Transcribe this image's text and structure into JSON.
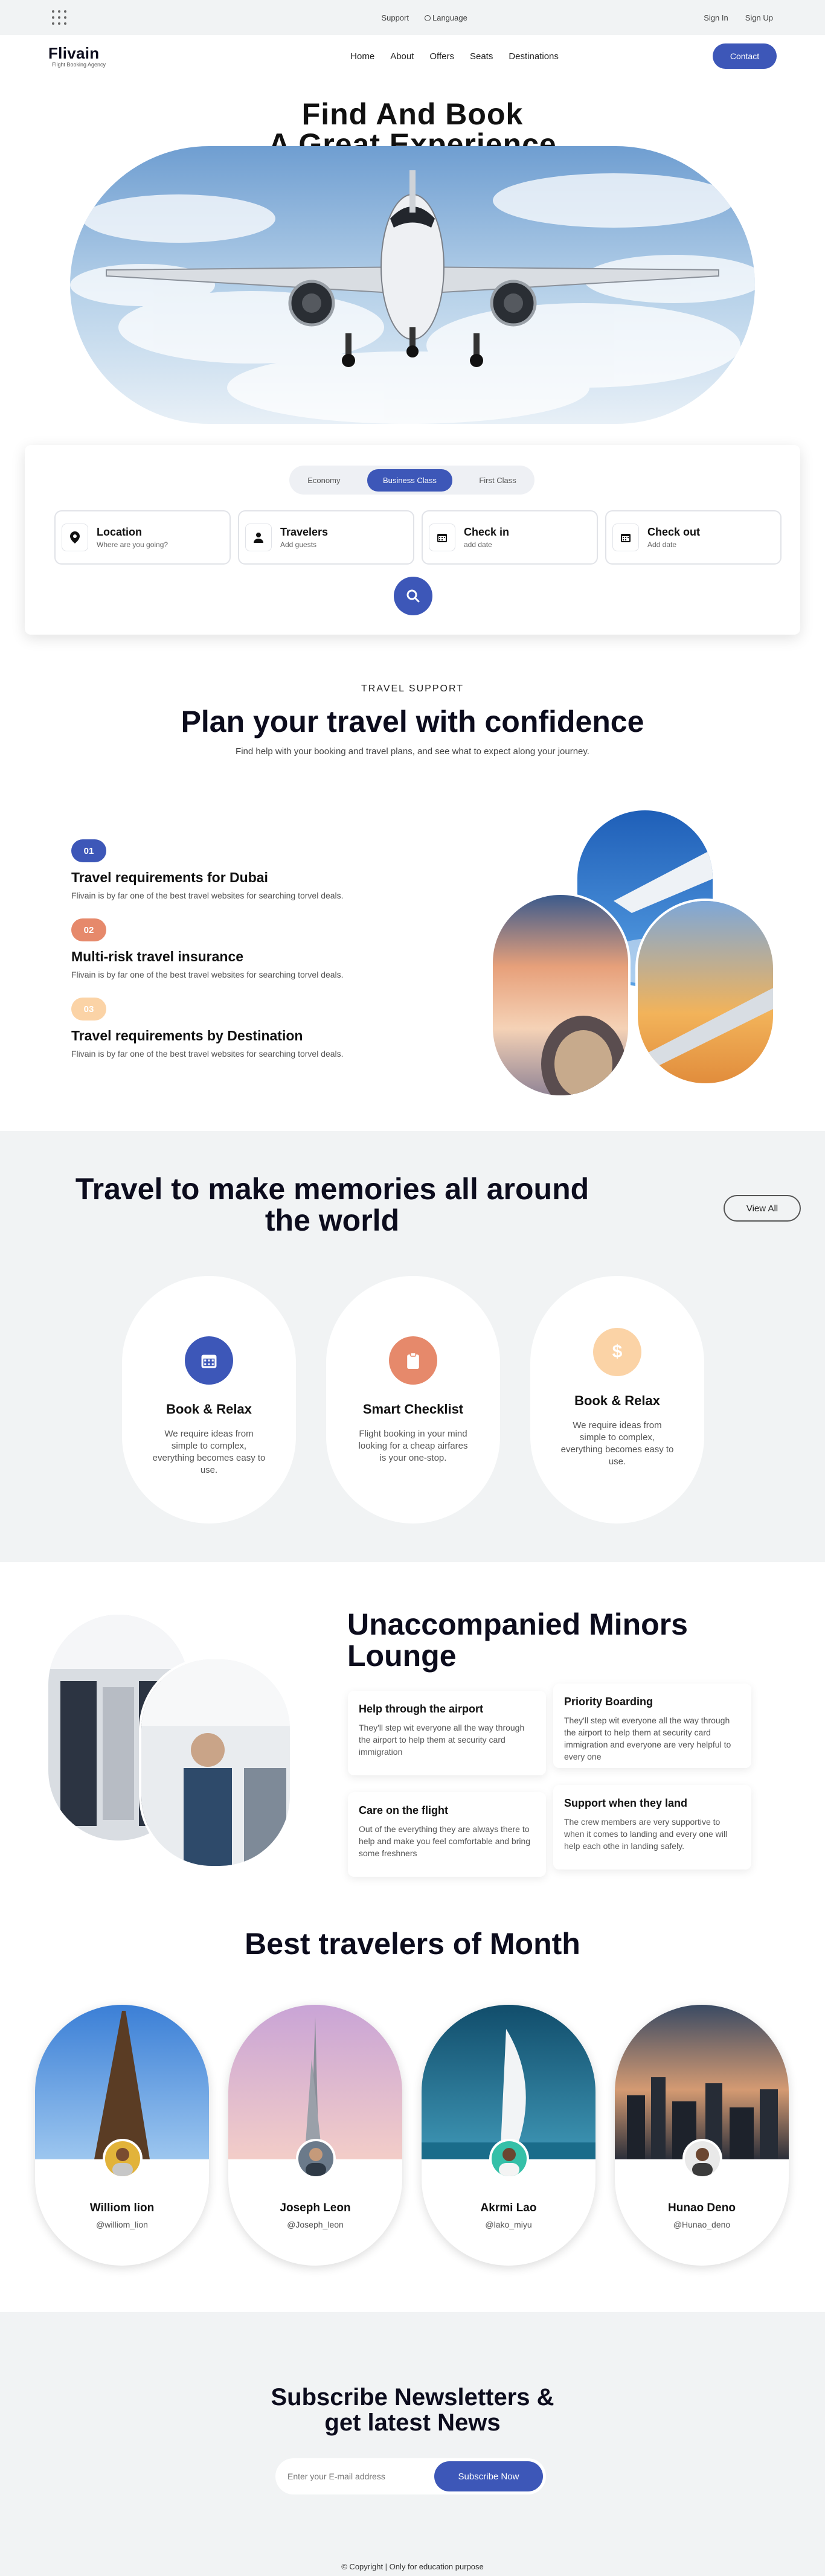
{
  "topbar": {
    "support": "Support",
    "language": "Language",
    "signin": "Sign In",
    "signup": "Sign Up"
  },
  "nav": {
    "logo": "Flivain",
    "tagline": "Flight Booking Agency",
    "items": [
      "Home",
      "About",
      "Offers",
      "Seats",
      "Destinations"
    ],
    "contact": "Contact"
  },
  "hero": {
    "line1": "Find And Book",
    "line2": "A Great Experience"
  },
  "booking": {
    "classes": [
      "Economy",
      "Business Class",
      "First Class"
    ],
    "active_class": "Business Class",
    "fields": [
      {
        "title": "Location",
        "sub": "Where are you going?",
        "icon": "location-pin-icon"
      },
      {
        "title": "Travelers",
        "sub": "Add guests",
        "icon": "user-icon"
      },
      {
        "title": "Check in",
        "sub": "add date",
        "icon": "calendar-icon"
      },
      {
        "title": "Check out",
        "sub": "Add date",
        "icon": "calendar-icon"
      }
    ]
  },
  "support": {
    "label": "TRAVEL SUPPORT",
    "title": "Plan your travel with confidence",
    "desc": "Find help with your booking and travel plans, and see what to expect along your journey.",
    "steps": [
      {
        "num": "01",
        "title": "Travel requirements for Dubai",
        "desc": "Flivain is by far one of the best travel websites for searching torvel deals.",
        "color": "#3d57b8"
      },
      {
        "num": "02",
        "title": "Multi-risk travel insurance",
        "desc": "Flivain is by far one of the best travel websites for searching torvel deals.",
        "color": "#e6896b"
      },
      {
        "num": "03",
        "title": "Travel requirements by Destination",
        "desc": "Flivain is by far one of the best travel websites for searching torvel deals.",
        "color": "#fbd3a6"
      }
    ]
  },
  "memories": {
    "title_line1": "Travel to make memories all around",
    "title_line2": "the world",
    "view_all": "View All",
    "cards": [
      {
        "title": "Book & Relax",
        "desc": "We require ideas from simple to complex, everything becomes easy to use.",
        "icon": "calendar-icon",
        "color": "#3d57b8"
      },
      {
        "title": "Smart Checklist",
        "desc": "Flight booking in your mind looking for a cheap airfares is your one-stop.",
        "icon": "clipboard-icon",
        "color": "#e6896b"
      },
      {
        "title": "Book & Relax",
        "desc": "We require ideas from simple to complex, everything becomes easy to use.",
        "icon": "dollar-icon",
        "color": "#fbd3a6"
      }
    ]
  },
  "minors": {
    "title_line1": "Unaccompanied Minors",
    "title_line2": "Lounge",
    "items": [
      {
        "title": "Help through the airport",
        "desc": "They'll step wit everyone all the way through the airport to help them at security card immigration"
      },
      {
        "title": "Priority Boarding",
        "desc": "They'll step wit everyone all the way through the airport to help them at security card immigration and everyone are very helpful to every one"
      },
      {
        "title": "Care on the flight",
        "desc": "Out of the everything they are always there to help and make you feel comfortable and bring some freshners"
      },
      {
        "title": "Support when they land",
        "desc": "The crew members are very supportive to when it comes to landing and every one will help each othe in landing safely."
      }
    ]
  },
  "travelers": {
    "title": "Best travelers of Month",
    "people": [
      {
        "name": "Williom lion",
        "handle": "@williom_lion"
      },
      {
        "name": "Joseph Leon",
        "handle": "@Joseph_leon"
      },
      {
        "name": "Akrmi Lao",
        "handle": "@lako_miyu"
      },
      {
        "name": "Hunao Deno",
        "handle": "@Hunao_deno"
      }
    ]
  },
  "newsletter": {
    "title_line1": "Subscribe Newsletters &",
    "title_line2": "get latest News",
    "placeholder": "Enter your E-mail address",
    "button": "Subscribe Now",
    "copyright": "© Copyright | Only for education purpose"
  }
}
